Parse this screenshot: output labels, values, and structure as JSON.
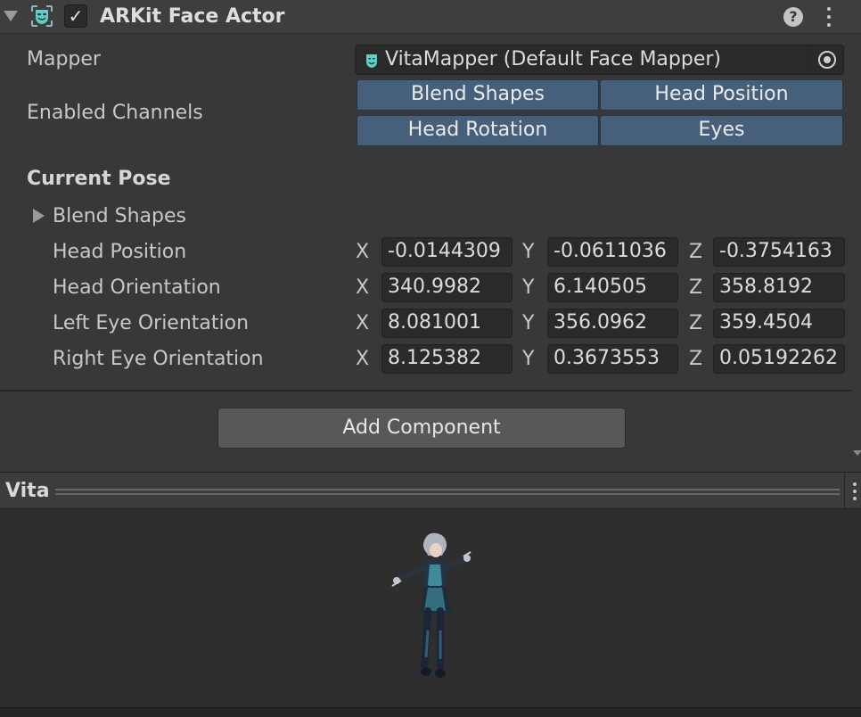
{
  "component": {
    "title": "ARKit Face Actor",
    "enabled": true,
    "icon": "face-mask-icon",
    "help_icon": "?",
    "menu_icon": "kebab-menu-icon"
  },
  "mapper": {
    "label": "Mapper",
    "value": "VitaMapper (Default Face Mapper)",
    "icon": "face-mapper-asset-icon",
    "picker_icon": "object-picker-icon"
  },
  "channels": {
    "label": "Enabled Channels",
    "buttons": [
      "Blend Shapes",
      "Head Position",
      "Head Rotation",
      "Eyes"
    ],
    "active_color": "#46607c"
  },
  "current_pose": {
    "title": "Current Pose",
    "blend_shapes_label": "Blend Shapes",
    "axes": [
      "X",
      "Y",
      "Z"
    ],
    "rows": [
      {
        "label": "Head Position",
        "x": "-0.0144309",
        "y": "-0.0611036",
        "z": "-0.3754163"
      },
      {
        "label": "Head Orientation",
        "x": "340.9982",
        "y": "6.140505",
        "z": "358.8192"
      },
      {
        "label": "Left Eye Orientation",
        "x": "8.081001",
        "y": "356.0962",
        "z": "359.4504"
      },
      {
        "label": "Right Eye Orientation",
        "x": "8.125382",
        "y": "0.3673553",
        "z": "0.05192262"
      }
    ]
  },
  "add_component": {
    "label": "Add Component"
  },
  "preview": {
    "title": "Vita"
  },
  "colors": {
    "background": "#383838",
    "field": "#2a2a2a",
    "button": "#585858",
    "preview_bg": "#2e2e2e"
  }
}
